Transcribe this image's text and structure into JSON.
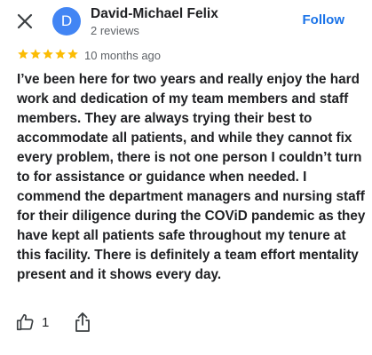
{
  "header": {
    "avatar_letter": "D",
    "reviewer_name": "David-Michael Felix",
    "reviewer_meta": "2 reviews",
    "follow_label": "Follow"
  },
  "review": {
    "rating": 5,
    "time": "10 months ago",
    "text": "I’ve been here for two years and really enjoy the hard work and dedication of my team members and staff members. They are always trying their best to accommodate all patients, and while they cannot fix every problem, there is not one person I couldn’t turn to for assistance or guidance when needed. I commend the department managers and nursing staff for their diligence during the COViD pandemic as they have kept all patients safe throughout my tenure at this facility. There is definitely a team effort mentality present and it shows every day."
  },
  "actions": {
    "like_count": "1"
  },
  "colors": {
    "accent": "#1a73e8",
    "avatar": "#4285f4",
    "star": "#fbbc04"
  }
}
